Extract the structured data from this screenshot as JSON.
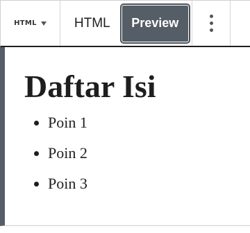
{
  "toolbar": {
    "block_switcher_label": "HTML",
    "tabs": [
      {
        "label": "HTML",
        "active": false
      },
      {
        "label": "Preview",
        "active": true
      }
    ],
    "more_options_icon": "kebab-vertical-icon"
  },
  "preview": {
    "heading": "Daftar Isi",
    "items": [
      "Poin 1",
      "Poin 2",
      "Poin 3"
    ]
  },
  "colors": {
    "active_tab_bg": "#555d66",
    "active_tab_text": "#ffffff",
    "accent_border": "#555d66"
  }
}
